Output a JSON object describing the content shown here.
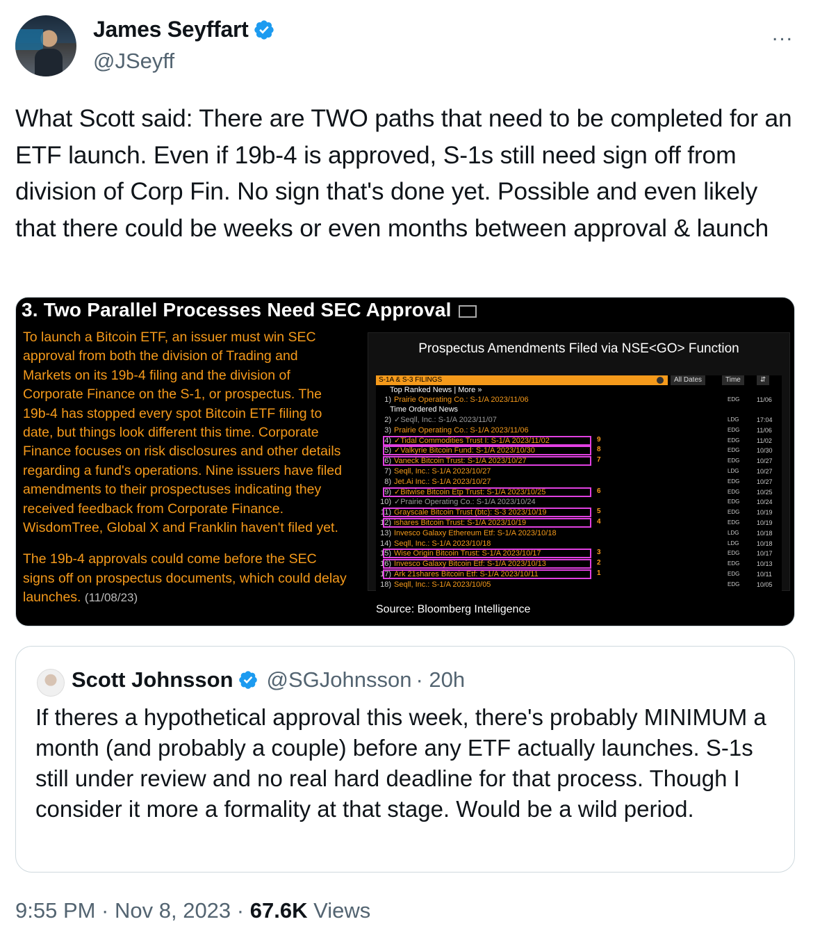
{
  "tweet": {
    "author_name": "James Seyffart",
    "author_handle": "@JSeyff",
    "more_icon": "...",
    "text": "What Scott said: There are TWO paths that need to be completed for an ETF launch. Even if 19b-4 is approved, S-1s still need sign off from division of Corp Fin. No sign that's done yet. Possible and even likely that there could be weeks or even months between approval & launch",
    "timestamp": "9:55 PM · Nov 8, 2023 ·",
    "views_count": "67.6K",
    "views_label": "Views"
  },
  "media": {
    "title": "3. Two Parallel Processes Need SEC Approval",
    "para1": "To launch a Bitcoin ETF, an issuer must win SEC approval from both the division of Trading and Markets on its 19b-4 filing and the division of Corporate Finance on the S-1, or prospectus. The 19b-4 has stopped every spot Bitcoin ETF filing to date, but things look different this time. Corporate Finance focuses on risk disclosures and other details regarding a fund's operations. Nine issuers have filed amendments to their prospectuses indicating they received feedback from Corporate Finance. WisdomTree, Global X and Franklin haven't filed yet.",
    "para2": "The 19b-4 approvals could come before the SEC signs off on prospectus documents, which could delay launches.",
    "para2_date": "(11/08/23)",
    "panel_title": "Prospectus Amendments Filed via NSE<GO> Function",
    "bar_label": "S-1A & S-3 FILINGS",
    "all_dates": "All Dates",
    "time_btn": "Time",
    "top_ranked": "Top Ranked News | More »",
    "time_ordered": "Time Ordered News",
    "source": "Source: Bloomberg Intelligence",
    "rows": [
      {
        "n": "1)",
        "t": "Prairie Operating Co.: S-1/A 2023/11/06",
        "s": "EDG",
        "d": "11/06"
      },
      {
        "n": "2)",
        "t": "✓Seqll, Inc.: S-1/A 2023/11/07",
        "s": "LDG",
        "d": "17:04"
      },
      {
        "n": "3)",
        "t": "Prairie Operating Co.: S-1/A 2023/11/06",
        "s": "EDG",
        "d": "11/06"
      },
      {
        "n": "4)",
        "t": "✓Tidal Commodities Trust I: S-1/A 2023/11/02",
        "s": "EDG",
        "d": "11/02"
      },
      {
        "n": "5)",
        "t": "✓Valkyrie Bitcoin Fund: S-1/A 2023/10/30",
        "s": "EDG",
        "d": "10/30"
      },
      {
        "n": "6)",
        "t": "Vaneck Bitcoin Trust: S-1/A 2023/10/27",
        "s": "EDG",
        "d": "10/27"
      },
      {
        "n": "7)",
        "t": "Seqll, Inc.: S-1/A 2023/10/27",
        "s": "LDG",
        "d": "10/27"
      },
      {
        "n": "8)",
        "t": "Jet.Ai Inc.: S-1/A 2023/10/27",
        "s": "EDG",
        "d": "10/27"
      },
      {
        "n": "9)",
        "t": "✓Bitwise Bitcoin Etp Trust: S-1/A 2023/10/25",
        "s": "EDG",
        "d": "10/25"
      },
      {
        "n": "10)",
        "t": "✓Prairie Operating Co.: S-1/A 2023/10/24",
        "s": "EDG",
        "d": "10/24"
      },
      {
        "n": "11)",
        "t": "Grayscale Bitcoin Trust (btc): S-3 2023/10/19",
        "s": "EDG",
        "d": "10/19"
      },
      {
        "n": "12)",
        "t": "ishares Bitcoin Trust: S-1/A 2023/10/19",
        "s": "EDG",
        "d": "10/19"
      },
      {
        "n": "13)",
        "t": "Invesco Galaxy Ethereum Etf: S-1/A 2023/10/18",
        "s": "LDG",
        "d": "10/18"
      },
      {
        "n": "14)",
        "t": "Seqll, Inc.: S-1/A 2023/10/18",
        "s": "LDG",
        "d": "10/18"
      },
      {
        "n": "15)",
        "t": "Wise Origin Bitcoin Trust: S-1/A 2023/10/17",
        "s": "EDG",
        "d": "10/17"
      },
      {
        "n": "16)",
        "t": "Invesco Galaxy Bitcoin Etf: S-1/A 2023/10/13",
        "s": "EDG",
        "d": "10/13"
      },
      {
        "n": "17)",
        "t": "Ark 21shares Bitcoin Etf: S-1/A 2023/10/11",
        "s": "EDG",
        "d": "10/11"
      },
      {
        "n": "18)",
        "t": "Seqll, Inc.: S-1/A 2023/10/05",
        "s": "EDG",
        "d": "10/05"
      }
    ],
    "ranks": [
      "9",
      "8",
      "7",
      "6",
      "5",
      "4",
      "3",
      "2",
      "1"
    ]
  },
  "quote": {
    "author_name": "Scott Johnsson",
    "author_handle": "@SGJohnsson",
    "time": "· 20h",
    "text": "If theres a hypothetical approval this week, there's probably MINIMUM a month (and probably a couple) before any ETF actually launches. S-1s still under review and no real hard deadline for that process. Though I consider it more a formality at that stage. Would be a wild period."
  },
  "colors": {
    "verified": "#1d9bf0",
    "bbg_orange": "#f59a1b",
    "highlight": "#e040e0"
  }
}
